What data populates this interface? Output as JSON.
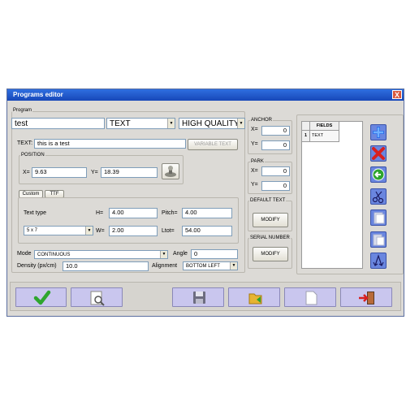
{
  "window": {
    "title": "Programs editor",
    "close": "X"
  },
  "program": {
    "group_label": "Program",
    "name_value": "test",
    "type_value": "TEXT",
    "quality_value": "HIGH QUALITY",
    "text_label": "TEXT:",
    "text_value": "this is a test",
    "variable_text_button": "VARIABLE TEXT"
  },
  "position": {
    "label": "POSITION",
    "x_label": "X=",
    "x_value": "9.63",
    "y_label": "Y=",
    "y_value": "18.39"
  },
  "tabs": [
    {
      "label": "Custom"
    },
    {
      "label": "TTF"
    }
  ],
  "custom": {
    "text_type_label": "Text type",
    "text_type_value": "5 x 7",
    "h_label": "H=",
    "h_value": "4.00",
    "w_label": "W=",
    "w_value": "2.00",
    "pitch_label": "Pitch=",
    "pitch_value": "4.00",
    "ltot_label": "Ltot=",
    "ltot_value": "54.00"
  },
  "mode": {
    "label": "Mode",
    "value": "CONTINUOUS"
  },
  "angle": {
    "label": "Angle",
    "value": "0"
  },
  "density": {
    "label": "Density (px/cm)",
    "value": "10.0"
  },
  "alignment": {
    "label": "Alignment",
    "value": "BOTTOM LEFT"
  },
  "anchor": {
    "label": "ANCHOR",
    "x_label": "X=",
    "x_value": "0",
    "y_label": "Y=",
    "y_value": "0"
  },
  "park": {
    "label": "PARK",
    "x_label": "X=",
    "x_value": "0",
    "y_label": "Y=",
    "y_value": "0"
  },
  "default_text": {
    "label": "DEFAULT TEXT",
    "button": "MODIFY"
  },
  "serial_number": {
    "label": "SERIAL NUMBER",
    "button": "MODIFY"
  },
  "fields": {
    "header": "FIELDS",
    "rows": [
      {
        "index": "1",
        "name": "TEXT"
      }
    ]
  },
  "icons": {
    "add": "plus-icon",
    "delete": "x-icon",
    "back": "back-arrow-icon",
    "cut": "scissors-icon",
    "copy": "copy-icon",
    "paste": "paste-icon",
    "move": "move-arrows-icon",
    "ok": "checkmark-icon",
    "preview": "magnifier-icon",
    "save": "floppy-disk-icon",
    "open": "open-folder-icon",
    "new": "new-document-icon",
    "exit": "exit-door-icon"
  },
  "colors": {
    "title_bar": "#1f56cc",
    "window_bg": "#dcdad6",
    "toolbar_button": "#c9c6ee",
    "side_button": "#6a86df",
    "accent_red": "#d82020",
    "accent_green": "#2ea52e"
  }
}
